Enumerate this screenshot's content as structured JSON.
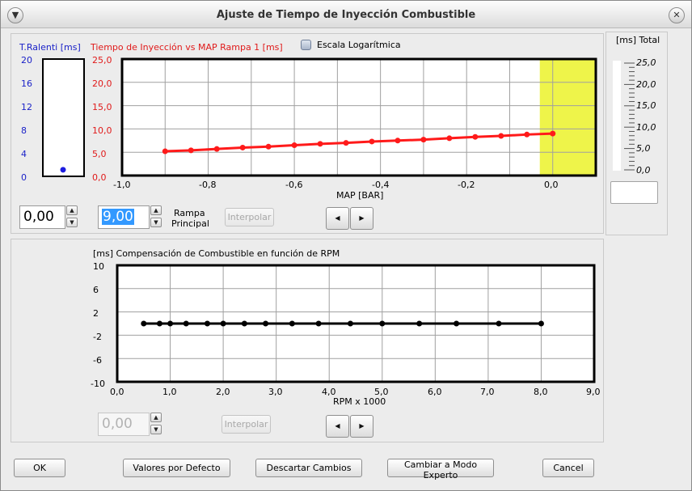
{
  "window": {
    "title": "Ajuste de Tiempo de Inyección Combustible"
  },
  "ralenti": {
    "title": "T.Ralenti [ms]",
    "ticks": [
      "20",
      "16",
      "12",
      "8",
      "4",
      "0"
    ],
    "value": 1,
    "ymax": 20
  },
  "main_chart": {
    "title": "Tiempo de Inyección vs MAP Rampa 1 [ms]",
    "log_label": "Escala Logarítmica",
    "xlabel": "MAP [BAR]",
    "yticks": [
      "25,0",
      "20,0",
      "15,0",
      "10,0",
      "5,0",
      "0,0"
    ],
    "xticks": [
      "-1,0",
      "-0,8",
      "-0,6",
      "-0,4",
      "-0,2",
      "0,0"
    ],
    "highlight_color": "#eef44a"
  },
  "total": {
    "title": "[ms] Total",
    "ticks": [
      "25,0",
      "20,0",
      "15,0",
      "10,0",
      "5,0",
      "0,0"
    ]
  },
  "controls1": {
    "field1": "0,00",
    "field2": "9,00",
    "rampa_label_1": "Rampa",
    "rampa_label_2": "Principal",
    "interpolar": "Interpolar"
  },
  "rpm_chart": {
    "title": "[ms] Compensación de Combustible en función de RPM",
    "xlabel": "RPM x 1000",
    "yticks": [
      "10",
      "6",
      "2",
      "-2",
      "-6",
      "-10"
    ],
    "xticks": [
      "0,0",
      "1,0",
      "2,0",
      "3,0",
      "4,0",
      "5,0",
      "6,0",
      "7,0",
      "8,0",
      "9,0"
    ]
  },
  "controls2": {
    "field": "0,00",
    "interpolar": "Interpolar"
  },
  "footer": {
    "ok": "OK",
    "defaults": "Valores por Defecto",
    "discard": "Descartar Cambios",
    "expert": "Cambiar a Modo Experto",
    "cancel": "Cancel"
  },
  "chart_data": [
    {
      "type": "line",
      "title": "Tiempo de Inyección vs MAP Rampa 1 [ms]",
      "xlabel": "MAP [BAR]",
      "ylabel": "",
      "xlim": [
        -1.0,
        0.1
      ],
      "ylim": [
        0,
        25
      ],
      "grid": true,
      "highlight_x_range": [
        -0.03,
        0.1
      ],
      "color": "#ff1a1a",
      "x": [
        -0.9,
        -0.84,
        -0.78,
        -0.72,
        -0.66,
        -0.6,
        -0.54,
        -0.48,
        -0.42,
        -0.36,
        -0.3,
        -0.24,
        -0.18,
        -0.12,
        -0.06,
        0.0
      ],
      "y": [
        5.2,
        5.4,
        5.7,
        6.0,
        6.2,
        6.5,
        6.8,
        7.0,
        7.3,
        7.5,
        7.7,
        8.0,
        8.3,
        8.5,
        8.8,
        9.0
      ]
    },
    {
      "type": "line",
      "title": "[ms] Compensación de Combustible en función de RPM",
      "xlabel": "RPM x 1000",
      "ylabel": "",
      "xlim": [
        0,
        9
      ],
      "ylim": [
        -10,
        10
      ],
      "grid": true,
      "color": "#000000",
      "x": [
        0.5,
        0.8,
        1.0,
        1.3,
        1.7,
        2.0,
        2.4,
        2.8,
        3.3,
        3.8,
        4.4,
        5.0,
        5.7,
        6.4,
        7.2,
        8.0
      ],
      "y": [
        0,
        0,
        0,
        0,
        0,
        0,
        0,
        0,
        0,
        0,
        0,
        0,
        0,
        0,
        0,
        0
      ]
    }
  ]
}
